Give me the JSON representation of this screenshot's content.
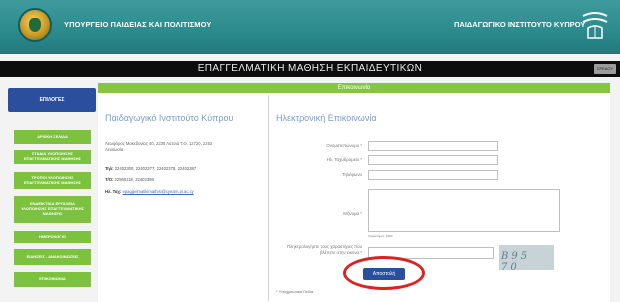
{
  "header": {
    "ministry": "ΥΠΟΥΡΓΕΙΟ ΠΑΙΔΕΙΑΣ ΚΑΙ ΠΟΛΙΤΙΣΜΟΥ",
    "institute": "ΠΑΙΔΑΓΩΓΙΚΟ ΙΝΣΤΙΤΟΥΤΟ ΚΥΠΡΟΥ"
  },
  "site_title": "ΕΠΑΓΓΕΛΜΑΤΙΚΗ ΜΑΘΗΣΗ ΕΚΠΑΙΔΕΥΤΙΚΩΝ",
  "search_label": "ΣΡΕΔΟΥ",
  "sidebar": {
    "heading": "ΕΠΙΛΟΓΕΣ",
    "items": [
      {
        "label": "ΑΡΧΙΚΗ ΣΕΛΙΔΑ"
      },
      {
        "label": "ΣΤΑΔΙΑ ΥΛΟΠΟΙΗΣΗΣ ΕΠΑΓΓΕΛΜΑΤΙΚΗΣ ΜΑΘΗΣΗΣ"
      },
      {
        "label": "ΤΡΟΠΟΙ ΥΛΟΠΟΙΗΣΗΣ ΕΠΑΓΓΕΛΜΑΤΙΚΗΣ ΜΑΘΗΣΗΣ"
      },
      {
        "label": "ΕΝΔΕΙΚΤΙΚΑ ΕΡΓΑΛΕΙΑ ΥΛΟΠΟΙΗΣΗΣ ΕΠΑΓΓΕΛΜΑΤΙΚΗΣ ΜΑΘΗΣΗΣ"
      },
      {
        "label": "ΗΜΕΡΟΛΟΓΙΟ"
      },
      {
        "label": "ΕΙΔΗΣΕΙΣ - ΑΝΑΚΟΙΝΩΣΕΙΣ"
      },
      {
        "label": "ΕΠΙΚΟΙΝΩΝΙΑ"
      }
    ]
  },
  "main": {
    "ribbon": "Επικοινωνία",
    "left_heading": "Παιδαγωγικό Ινστιτούτο Κύπρου",
    "address": "Λεωφόρος Μακεδονίας 40, 2238 Λατσιά Τ.Θ. 12720, 2252 Λευκωσία",
    "tel_label": "Τηλ:",
    "tel_value": "22402300, 22402377, 22402378, 22402387",
    "fax_label": "Τ/Ο:",
    "fax_value": "22560118, 22402398",
    "email_label": "Ηλ. Ταχ:",
    "email_value": "epaggelmatikimathisi@cyearn.pi.ac.cy",
    "right_heading": "Ηλεκτρονική Επικοινωνία",
    "form": {
      "name_label": "Ονοματεπώνυμο *",
      "email_label": "Ηλ. Ταχυδρομείο *",
      "phone_label": "Τηλέφωνο",
      "message_label": "Μήνυμα *",
      "chars_left": "Χαρακτήρες: 1000",
      "captcha_label": "Πληκτρολογήστε τους χαρακτήρες που βλέπετε στην εικόνα *",
      "captcha_text": "B95 70",
      "send": "Αποστολή",
      "required_note": "* Υποχρεωτικά Πεδία"
    }
  },
  "colors": {
    "header": "#2b8a8d",
    "green": "#7cc23e",
    "blue": "#2b4f9c",
    "highlight": "#e02020"
  }
}
